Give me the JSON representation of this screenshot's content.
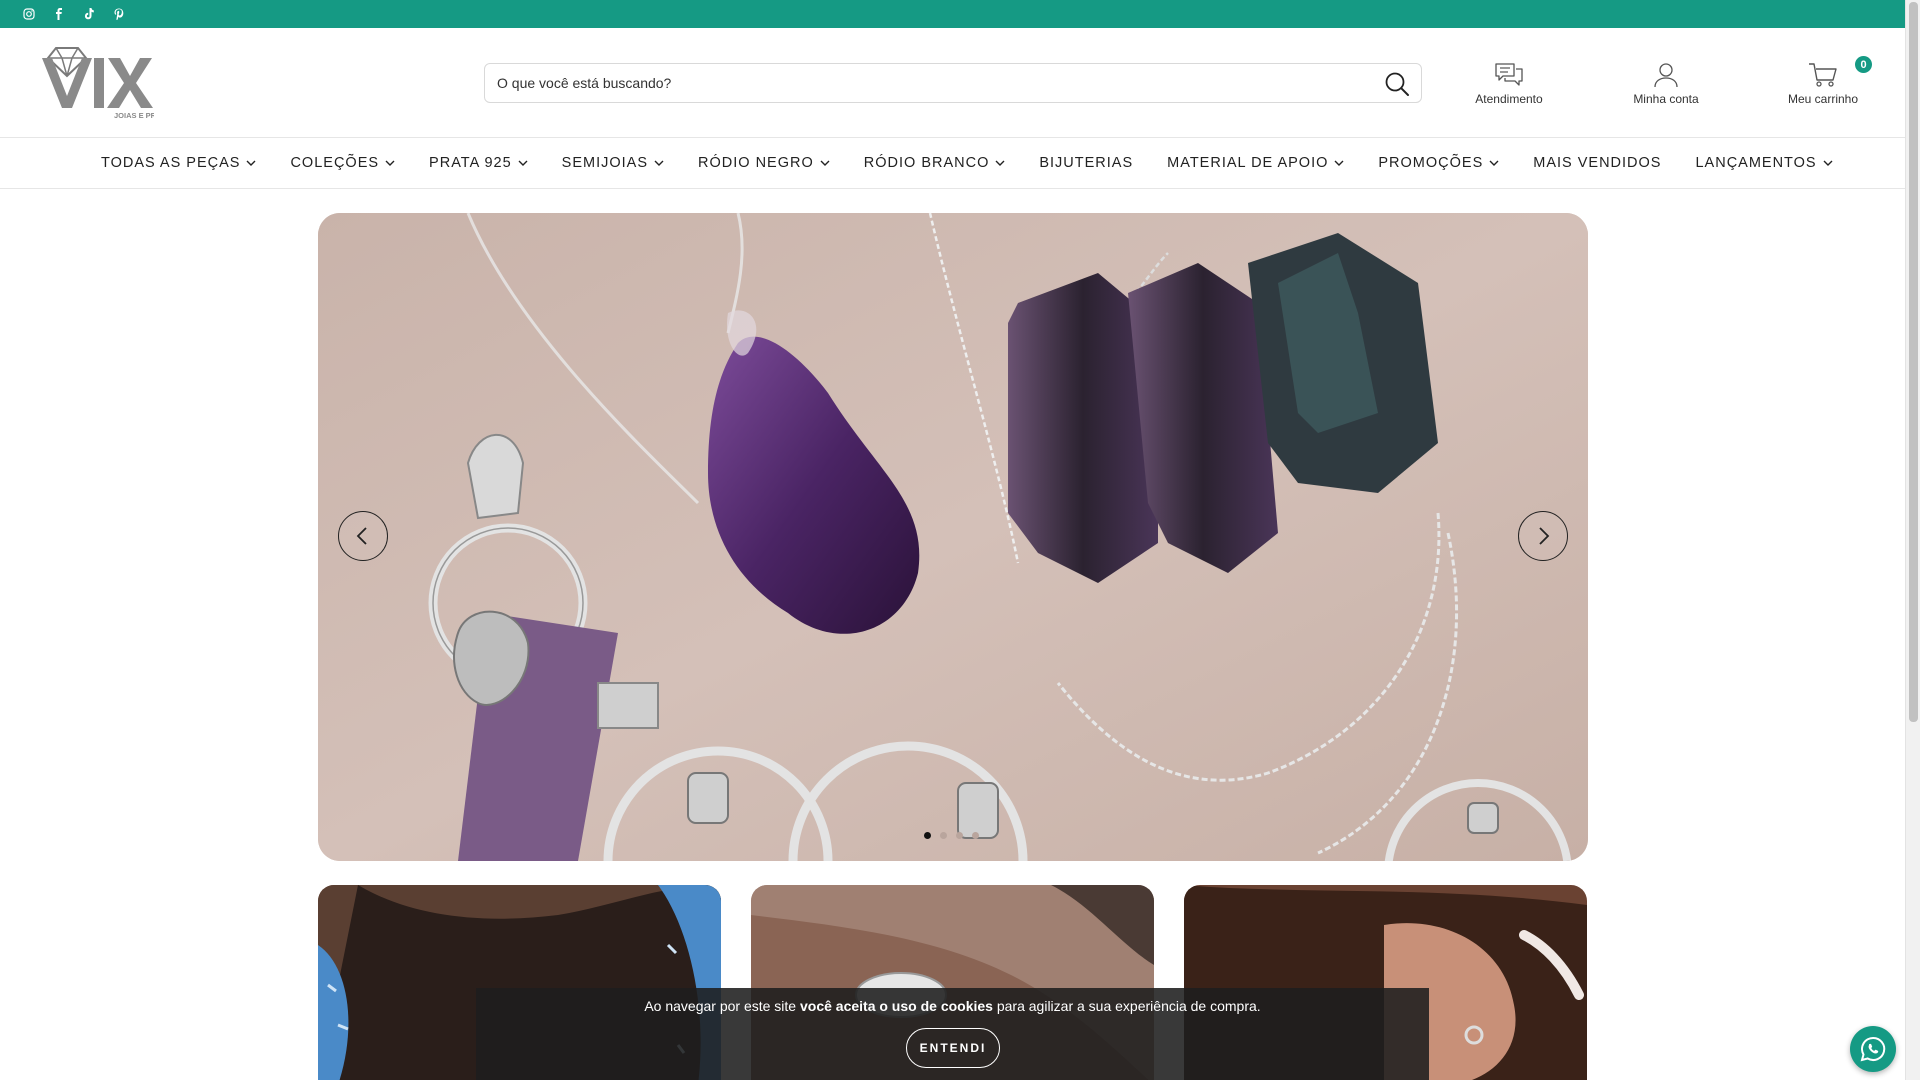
{
  "topbar": {
    "social_icons": [
      "instagram-icon",
      "facebook-icon",
      "tiktok-icon",
      "pinterest-icon"
    ],
    "color": "#159a84"
  },
  "header": {
    "logo_text": "VIX",
    "logo_subtext": "JOIAS E PRATAS",
    "search_placeholder": "O que você está buscando?",
    "support_label": "Atendimento",
    "account_label": "Minha conta",
    "cart_label": "Meu carrinho",
    "cart_count": "0"
  },
  "nav": {
    "items": [
      {
        "label": "TODAS AS PEÇAS",
        "dropdown": true
      },
      {
        "label": "COLEÇÕES",
        "dropdown": true
      },
      {
        "label": "PRATA 925",
        "dropdown": true
      },
      {
        "label": "SEMIJOIAS",
        "dropdown": true
      },
      {
        "label": "RÓDIO NEGRO",
        "dropdown": true
      },
      {
        "label": "RÓDIO BRANCO",
        "dropdown": true
      },
      {
        "label": "BIJUTERIAS",
        "dropdown": false
      },
      {
        "label": "MATERIAL DE APOIO",
        "dropdown": true
      },
      {
        "label": "PROMOÇÕES",
        "dropdown": true
      },
      {
        "label": "MAIS VENDIDOS",
        "dropdown": false
      },
      {
        "label": "LANÇAMENTOS",
        "dropdown": true
      }
    ]
  },
  "hero": {
    "slides_count": 4,
    "active_slide": 1
  },
  "cookie": {
    "text_before": "Ao navegar por este site ",
    "text_bold": "você aceita o uso de cookies",
    "text_after": " para agilizar a sua experiência de compra.",
    "button_label": "ENTENDI"
  },
  "colors": {
    "accent": "#159a84"
  }
}
